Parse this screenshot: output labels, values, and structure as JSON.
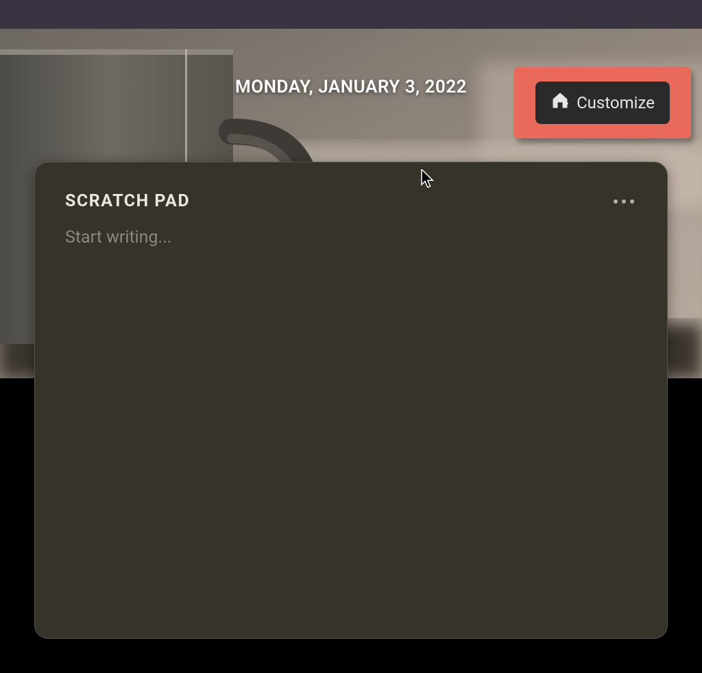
{
  "header": {
    "date": "MONDAY, JANUARY 3, 2022",
    "customize_label": "Customize"
  },
  "scratch_pad": {
    "title": "SCRATCH PAD",
    "placeholder": "Start writing..."
  }
}
